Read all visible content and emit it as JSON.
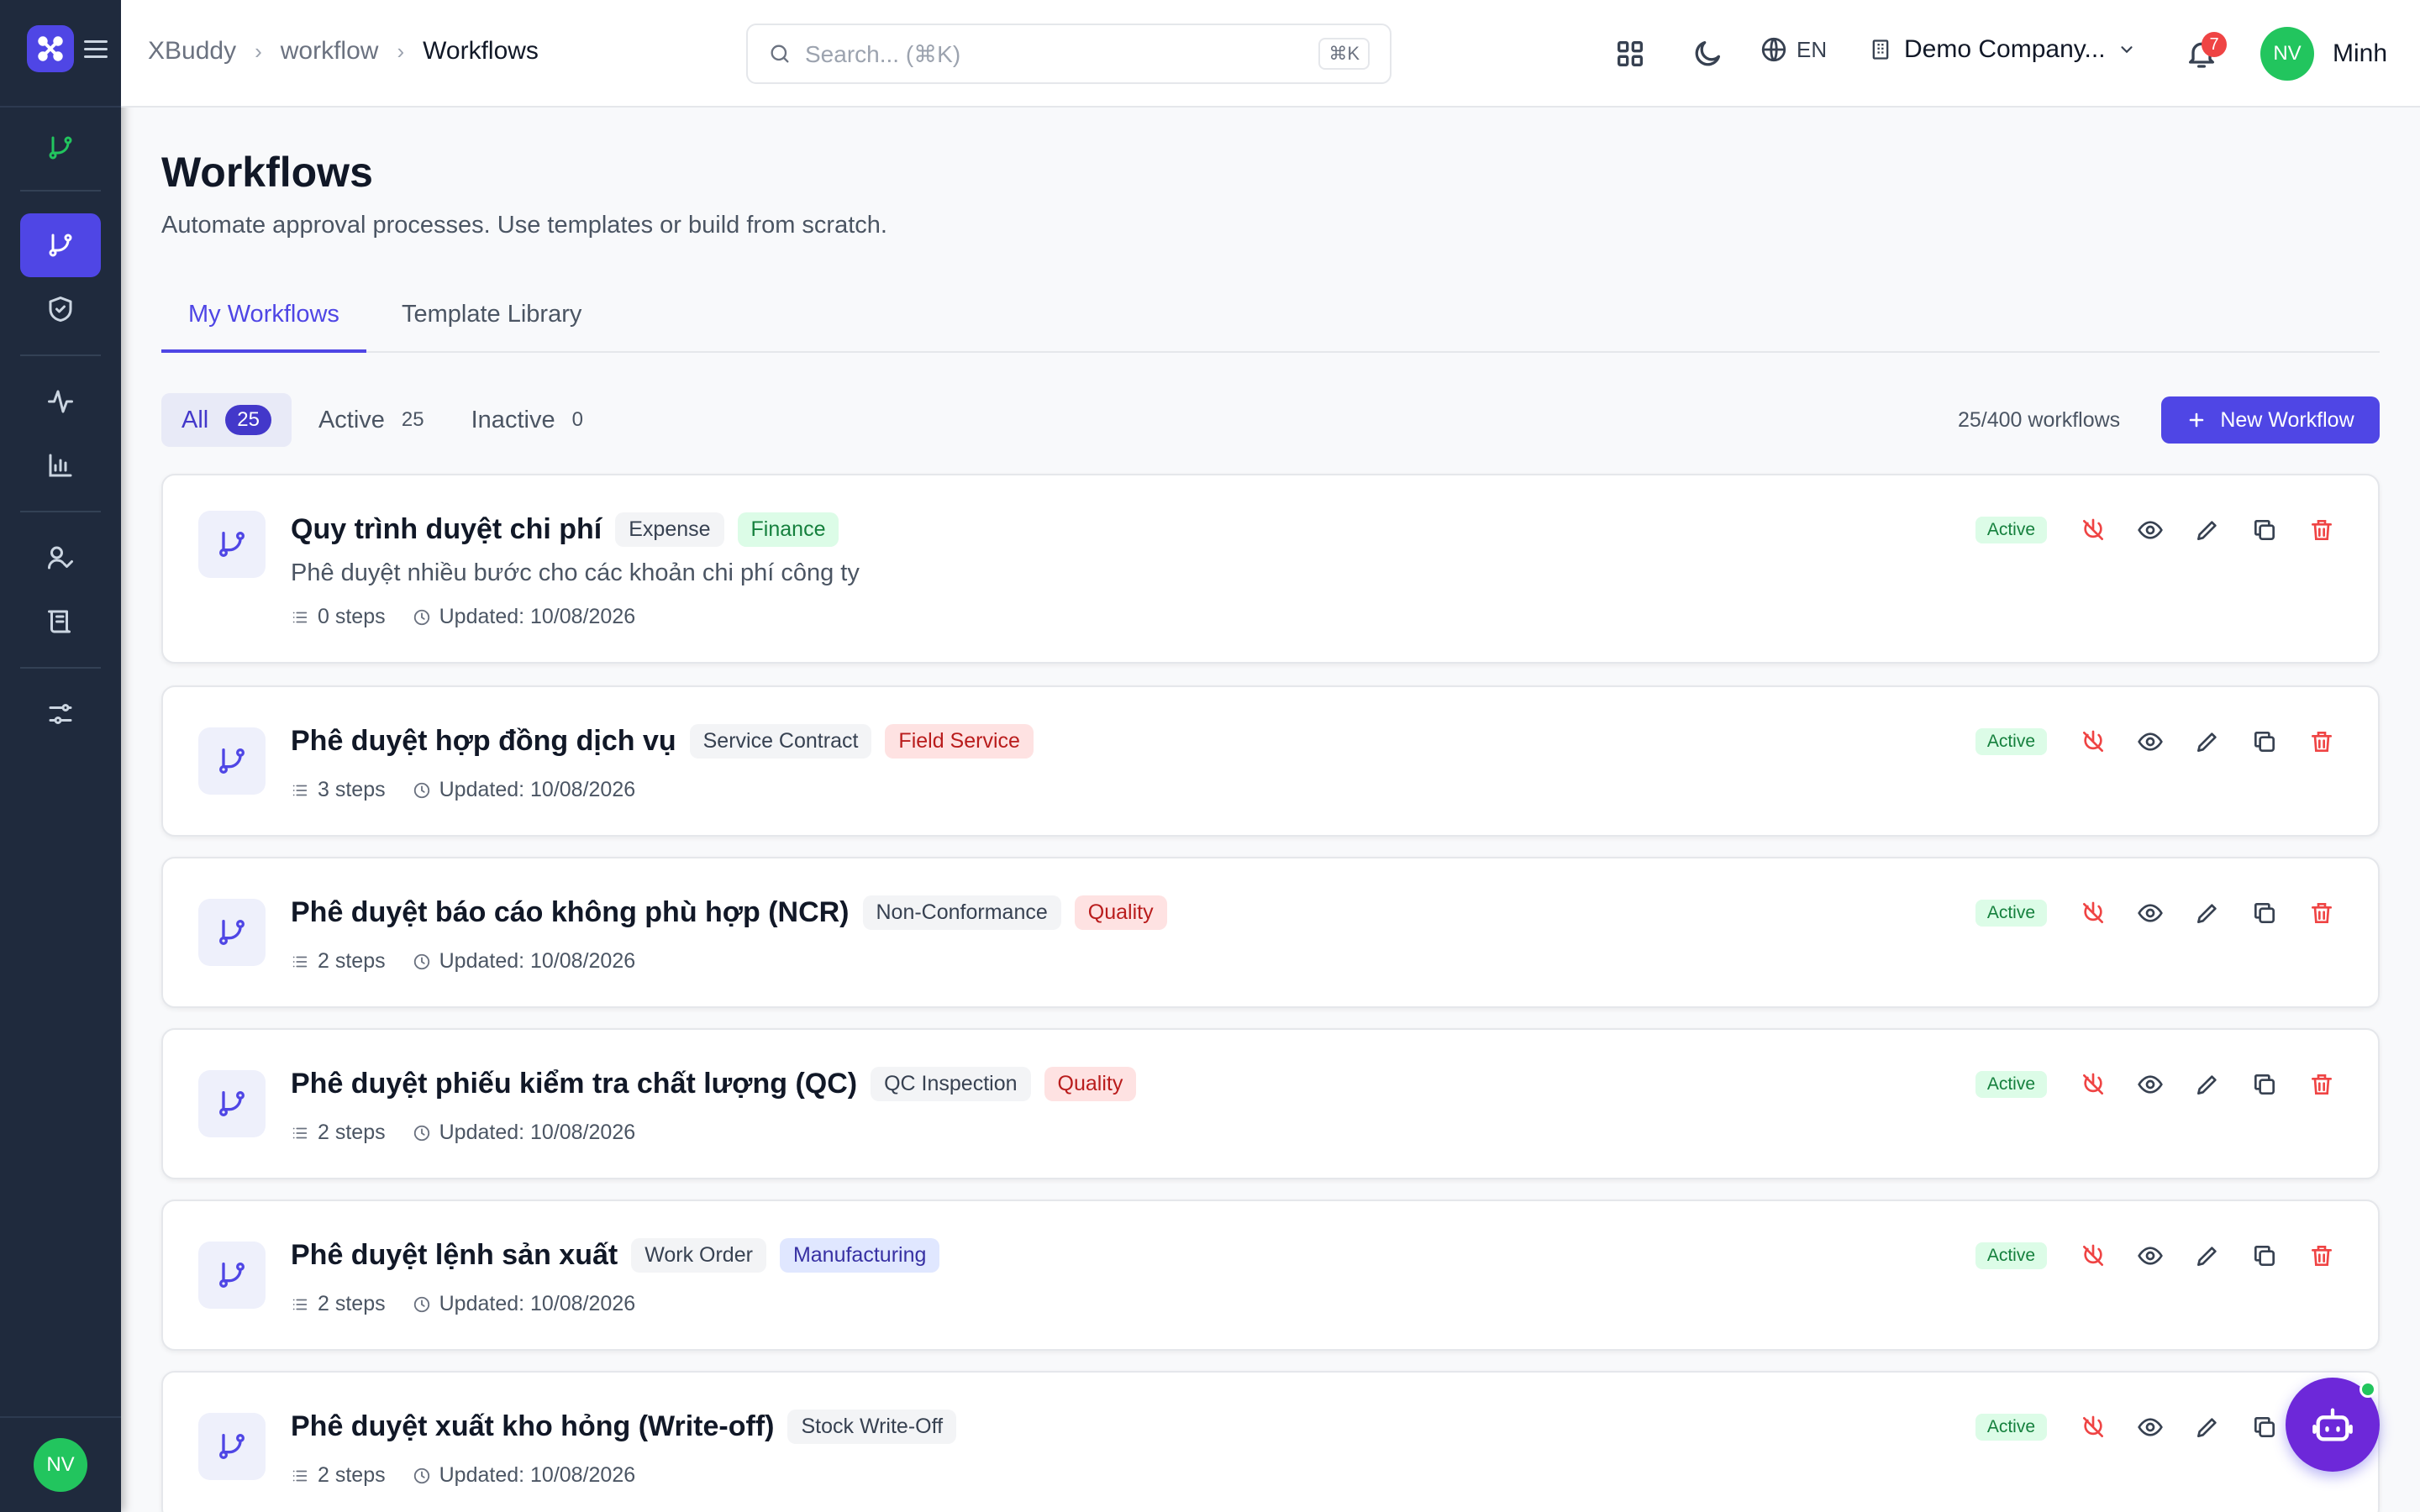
{
  "colors": {
    "accent": "#4f46e5",
    "sidebar": "#1f2a3d",
    "success": "#22c55e",
    "danger": "#ef4444"
  },
  "sidebar": {
    "logo": "xbuddy-logo-icon",
    "items": [
      {
        "icon": "git-branch-icon"
      },
      {
        "icon": "git-branch-icon",
        "active": true
      },
      {
        "icon": "shield-check-icon"
      },
      {
        "icon": "activity-icon"
      },
      {
        "icon": "bar-chart-icon"
      },
      {
        "icon": "user-check-icon"
      },
      {
        "icon": "scroll-icon"
      },
      {
        "icon": "sliders-icon"
      }
    ],
    "avatar": "NV"
  },
  "breadcrumb": {
    "items": [
      "XBuddy",
      "workflow"
    ],
    "current": "Workflows"
  },
  "search": {
    "placeholder": "Search... (⌘K)",
    "shortcut": "⌘K"
  },
  "header": {
    "language": "EN",
    "company": "Demo Company...",
    "notifications": "7",
    "user_initials": "NV",
    "user_name": "Minh"
  },
  "page": {
    "title": "Workflows",
    "subtitle": "Automate approval processes. Use templates or build from scratch."
  },
  "tabs": [
    {
      "label": "My Workflows",
      "active": true
    },
    {
      "label": "Template Library"
    }
  ],
  "filters": [
    {
      "label": "All",
      "count": "25",
      "active": true
    },
    {
      "label": "Active",
      "count": "25"
    },
    {
      "label": "Inactive",
      "count": "0"
    }
  ],
  "quota": "25/400 workflows",
  "new_button": "New Workflow",
  "workflows": [
    {
      "title": "Quy trình duyệt chi phí",
      "category": "Expense",
      "department": "Finance",
      "department_color": "green",
      "description": "Phê duyệt nhiều bước cho các khoản chi phí công ty",
      "steps": "0 steps",
      "updated": "Updated: 10/08/2026",
      "status": "Active"
    },
    {
      "title": "Phê duyệt hợp đồng dịch vụ",
      "category": "Service Contract",
      "department": "Field Service",
      "department_color": "red",
      "steps": "3 steps",
      "updated": "Updated: 10/08/2026",
      "status": "Active"
    },
    {
      "title": "Phê duyệt báo cáo không phù hợp (NCR)",
      "category": "Non-Conformance",
      "department": "Quality",
      "department_color": "red",
      "steps": "2 steps",
      "updated": "Updated: 10/08/2026",
      "status": "Active"
    },
    {
      "title": "Phê duyệt phiếu kiểm tra chất lượng (QC)",
      "category": "QC Inspection",
      "department": "Quality",
      "department_color": "red",
      "steps": "2 steps",
      "updated": "Updated: 10/08/2026",
      "status": "Active"
    },
    {
      "title": "Phê duyệt lệnh sản xuất",
      "category": "Work Order",
      "department": "Manufacturing",
      "department_color": "indigo",
      "steps": "2 steps",
      "updated": "Updated: 10/08/2026",
      "status": "Active"
    },
    {
      "title": "Phê duyệt xuất kho hỏng (Write-off)",
      "category": "Stock Write-Off",
      "steps": "2 steps",
      "updated": "Updated: 10/08/2026",
      "status": "Active"
    }
  ]
}
